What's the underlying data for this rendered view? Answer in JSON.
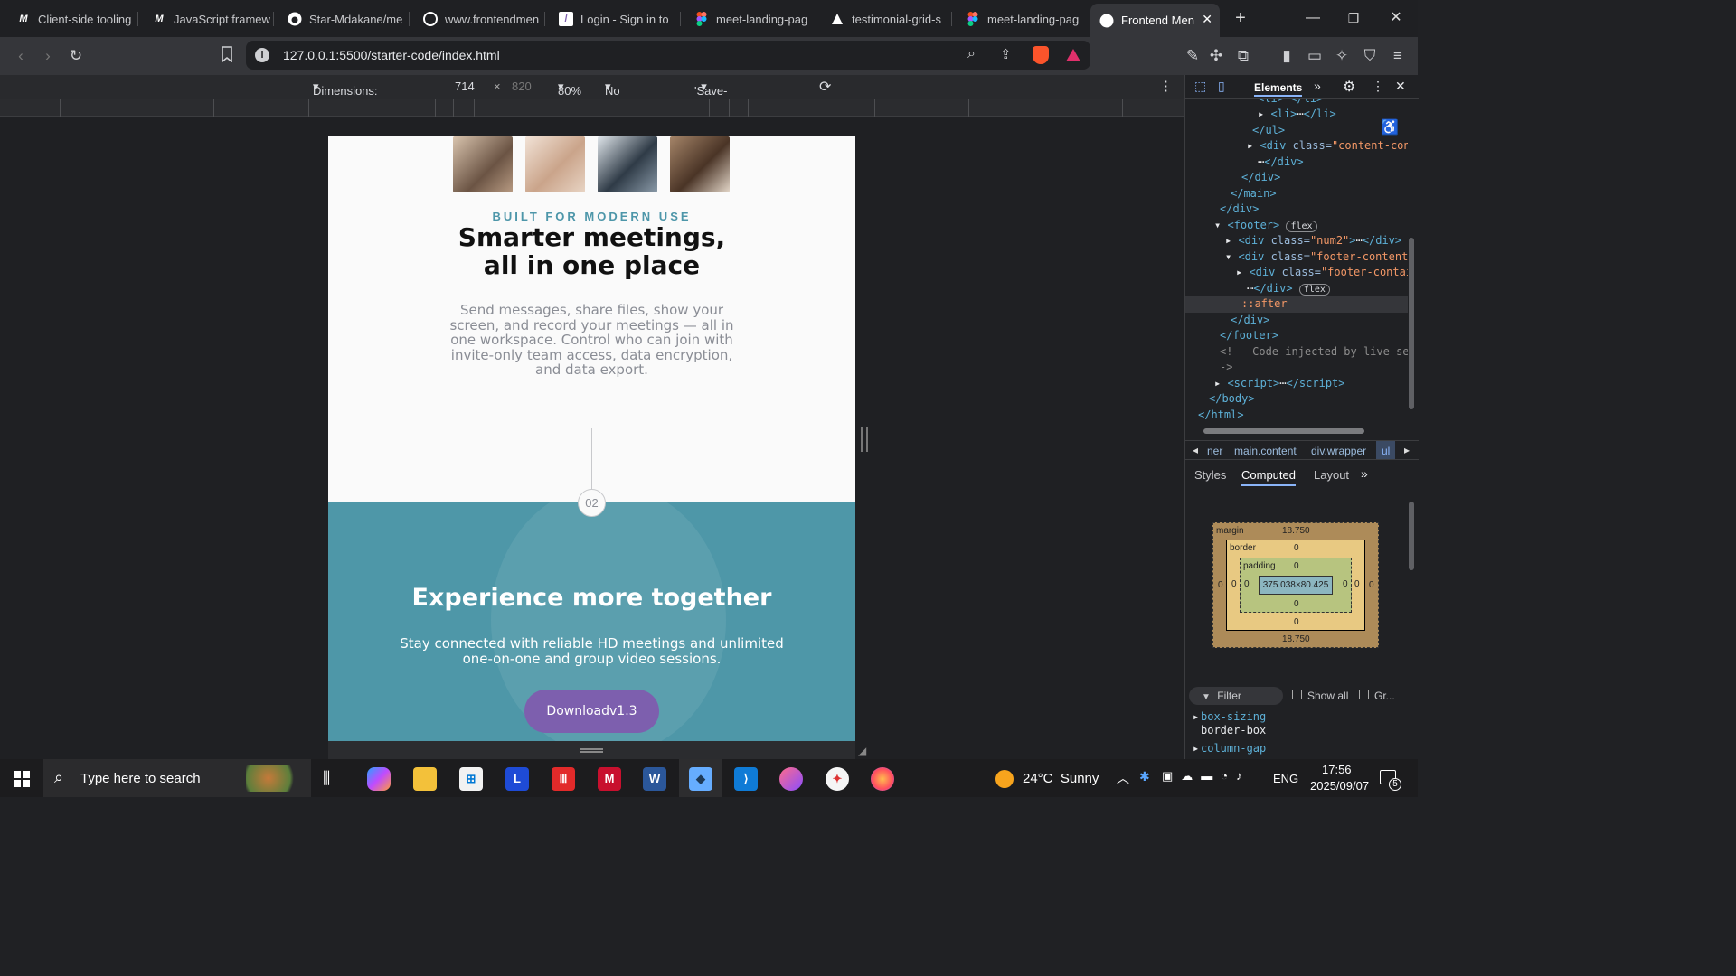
{
  "browser": {
    "tabs": [
      {
        "label": "Client-side tooling",
        "icon": "mdn-icon"
      },
      {
        "label": "JavaScript framew",
        "icon": "mdn-icon"
      },
      {
        "label": "Star-Mdakane/me",
        "icon": "github-icon"
      },
      {
        "label": "www.frontendmen",
        "icon": "globe-icon"
      },
      {
        "label": "Login - Sign in to",
        "icon": "login-icon"
      },
      {
        "label": "meet-landing-pag",
        "icon": "figma-icon"
      },
      {
        "label": "testimonial-grid-s",
        "icon": "vercel-icon"
      },
      {
        "label": "meet-landing-pag",
        "icon": "figma-icon"
      },
      {
        "label": "Frontend Men",
        "icon": "frontend-mentor-icon"
      }
    ],
    "url": "127.0.0.1:5500/starter-code/index.html"
  },
  "device_toolbar": {
    "dimensions_label": "Dimensions: Responsive",
    "width": "714",
    "height": "820",
    "zoom": "80%",
    "throttling": "No throttling",
    "save_data": "'Save-Data': default"
  },
  "page": {
    "eyebrow": "BUILT FOR MODERN USE",
    "headline": "Smarter meetings, all in one place",
    "body": "Send messages, share files, show your screen, and record your meetings — all in one workspace. Control who can join with invite-only team access, data encryption, and data export.",
    "step_badge": "02",
    "hero_title": "Experience more together",
    "hero_text": "Stay connected with reliable HD meetings and unlimited one-on-one and group video sessions.",
    "download_label": "Downloadv1.3",
    "hero_color": "#4e97a8",
    "button_color": "#7d5fae"
  },
  "devtools": {
    "active_tab": "Elements",
    "breadcrumbs": [
      "ner",
      "main.content",
      "div.wrapper",
      "ul"
    ],
    "subtabs": [
      "Styles",
      "Computed",
      "Layout"
    ],
    "active_subtab": "Computed",
    "box_model": {
      "margin_label": "margin",
      "margin_top": "18.750",
      "margin_bottom": "18.750",
      "border_label": "border",
      "padding_label": "padding",
      "content": "375.038×80.425",
      "zero": "0"
    },
    "filter_placeholder": "Filter",
    "show_all_label": "Show all",
    "group_label": "Gr...",
    "props": [
      {
        "name": "box-sizing",
        "value": "border-box"
      },
      {
        "name": "column-gap",
        "value": ""
      }
    ]
  },
  "taskbar": {
    "search_placeholder": "Type here to search",
    "weather": "24°C  Sunny",
    "lang": "ENG",
    "time": "17:56",
    "date": "2025/09/07",
    "notifications": "5"
  }
}
